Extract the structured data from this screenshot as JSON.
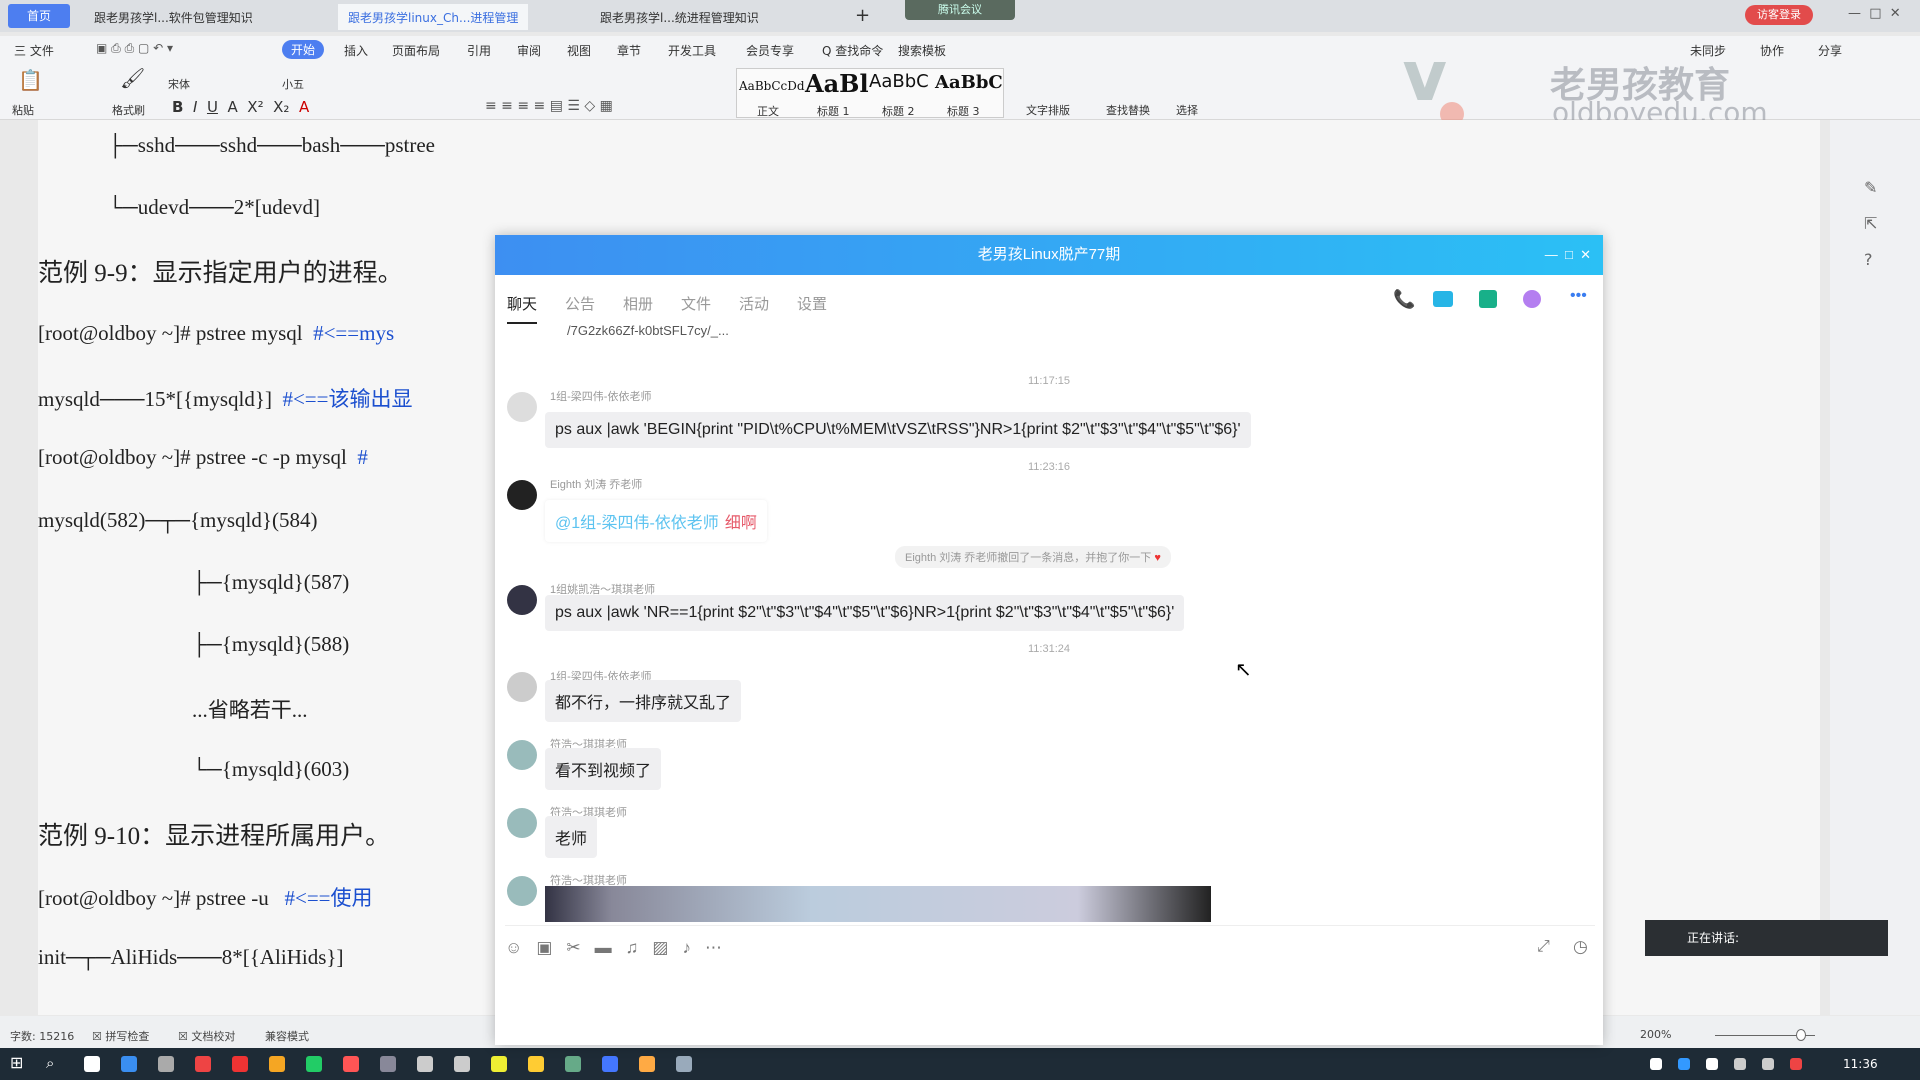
{
  "tabs": {
    "home": "首页",
    "items": [
      "跟老男孩学l...软件包管理知识",
      "跟老男孩学linux_Ch...进程管理",
      "跟老男孩学l...统进程管理知识"
    ],
    "add": "+",
    "meeting": "腾讯会议",
    "login": "访客登录"
  },
  "menu": [
    "三 文件",
    "开始",
    "插入",
    "页面布局",
    "引用",
    "审阅",
    "视图",
    "章节",
    "开发工具",
    "会员专享",
    "Q 查找命令",
    "搜索模板"
  ],
  "menu_right": [
    "未同步",
    "协作",
    "分享"
  ],
  "ribbon": {
    "paste": "粘贴",
    "format_painter": "格式刷",
    "font": "宋体",
    "size": "小五",
    "styles": [
      {
        "sample": "AaBbCcDd",
        "label": "正文"
      },
      {
        "sample": "AaBl",
        "label": "标题 1"
      },
      {
        "sample": "AaBbC",
        "label": "标题 2"
      },
      {
        "sample": "AaBbC",
        "label": "标题 3"
      }
    ],
    "text_layout": "文字排版",
    "find_replace": "查找替换",
    "select": "选择"
  },
  "watermark": {
    "cn": "老男孩教育",
    "en": "oldboyedu.com"
  },
  "document": {
    "lines": [
      {
        "t": "├─sshd───sshd───bash───pstree",
        "c": ""
      },
      {
        "t": "└─udevd───2*[udevd]",
        "c": ""
      },
      {
        "t": "范例 9-9：显示指定用户的进程。",
        "c": "",
        "h": true
      },
      {
        "t": "[root@oldboy ~]# pstree mysql  ",
        "c": "#<==mys"
      },
      {
        "t": "mysqld───15*[{mysqld}]  ",
        "c": "#<==该输出显"
      },
      {
        "t": "[root@oldboy ~]# pstree -c -p mysql  ",
        "c": "#"
      },
      {
        "t": "mysqld(582)─┬─{mysqld}(584)",
        "c": ""
      },
      {
        "t": "├─{mysqld}(587)",
        "c": ""
      },
      {
        "t": "├─{mysqld}(588)",
        "c": ""
      },
      {
        "t": "...省略若干...",
        "c": ""
      },
      {
        "t": "└─{mysqld}(603)",
        "c": ""
      },
      {
        "t": "范例 9-10：显示进程所属用户。",
        "c": "",
        "h": true
      },
      {
        "t": "[root@oldboy ~]# pstree -u   ",
        "c": "#<==使用"
      },
      {
        "t": "init─┬─AliHids───8*[{AliHids}]",
        "c": ""
      }
    ]
  },
  "status": {
    "words": "字数: 15216",
    "spell": "拼写检查",
    "proof": "文档校对",
    "compat": "兼容模式",
    "zoom": "200%"
  },
  "chat": {
    "title": "老男孩Linux脱产77期",
    "tabs": [
      "聊天",
      "公告",
      "相册",
      "文件",
      "活动",
      "设置"
    ],
    "top_snippet": "/7G2zk66Zf-k0btSFL7cy/_...",
    "times": [
      "11:17:15",
      "11:23:16",
      "11:31:24"
    ],
    "messages": [
      {
        "name": "1组-梁四伟-依依老师",
        "text": "ps aux |awk  'BEGIN{print \"PID\\t%CPU\\t%MEM\\tVSZ\\tRSS\"}NR>1{print $2\"\\t\"$3\"\\t\"$4\"\\t\"$5\"\\t\"$6}'"
      },
      {
        "name": "Eighth 刘涛 乔老师",
        "mention": "@1组-梁四伟-依依老师",
        "text": "细啊"
      },
      {
        "name": "1组姚凯浩～琪琪老师",
        "text": "ps aux |awk  'NR==1{print $2\"\\t\"$3\"\\t\"$4\"\\t\"$5\"\\t\"$6}NR>1{print $2\"\\t\"$3\"\\t\"$4\"\\t\"$5\"\\t\"$6}'"
      },
      {
        "name": "1组-梁四伟-依依老师",
        "text": "都不行，一排序就又乱了"
      },
      {
        "name": "符浩～琪琪老师",
        "text": "看不到视频了"
      },
      {
        "name": "符浩～琪琪老师",
        "text": "老师"
      },
      {
        "name": "符浩～琪琪老师",
        "text": ""
      }
    ],
    "notice": "Eighth 刘涛 乔老师撤回了一条消息，并抱了你一下"
  },
  "talking": "正在讲话:",
  "clock": "11:36",
  "colors": {
    "accent": "#4d7ef0",
    "chat_title_start": "#3d8ff2",
    "chat_title_end": "#2bc0f5",
    "taskbar": "#1e2b36"
  }
}
